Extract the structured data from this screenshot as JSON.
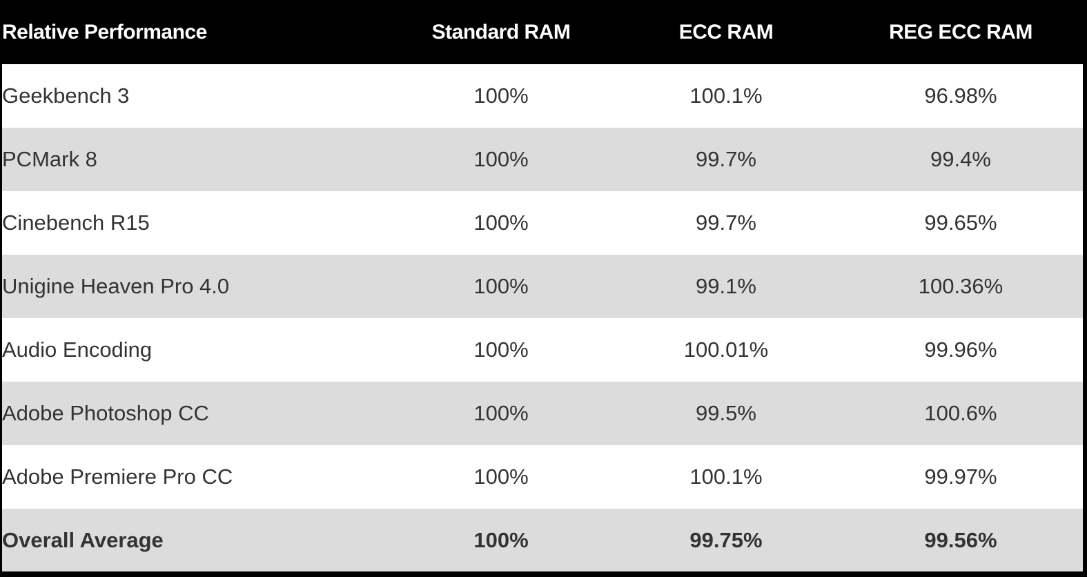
{
  "table": {
    "columns": [
      "Relative Performance",
      "Standard RAM",
      "ECC RAM",
      "REG ECC RAM"
    ],
    "rows": [
      {
        "benchmark": "Geekbench 3",
        "standard": "100%",
        "ecc": "100.1%",
        "reg_ecc": "96.98%"
      },
      {
        "benchmark": "PCMark 8",
        "standard": "100%",
        "ecc": "99.7%",
        "reg_ecc": "99.4%"
      },
      {
        "benchmark": "Cinebench R15",
        "standard": "100%",
        "ecc": "99.7%",
        "reg_ecc": "99.65%"
      },
      {
        "benchmark": "Unigine Heaven Pro 4.0",
        "standard": "100%",
        "ecc": "99.1%",
        "reg_ecc": "100.36%"
      },
      {
        "benchmark": "Audio Encoding",
        "standard": "100%",
        "ecc": "100.01%",
        "reg_ecc": "99.96%"
      },
      {
        "benchmark": "Adobe Photoshop CC",
        "standard": "100%",
        "ecc": "99.5%",
        "reg_ecc": "100.6%"
      },
      {
        "benchmark": "Adobe Premiere Pro CC",
        "standard": "100%",
        "ecc": "100.1%",
        "reg_ecc": "99.97%"
      }
    ],
    "total": {
      "benchmark": "Overall Average",
      "standard": "100%",
      "ecc": "99.75%",
      "reg_ecc": "99.56%"
    }
  },
  "colors": {
    "header_bg": "#000000",
    "header_text": "#ffffff",
    "row_odd_bg": "#ffffff",
    "row_even_bg": "#dcdcdc",
    "body_text": "#333333"
  }
}
